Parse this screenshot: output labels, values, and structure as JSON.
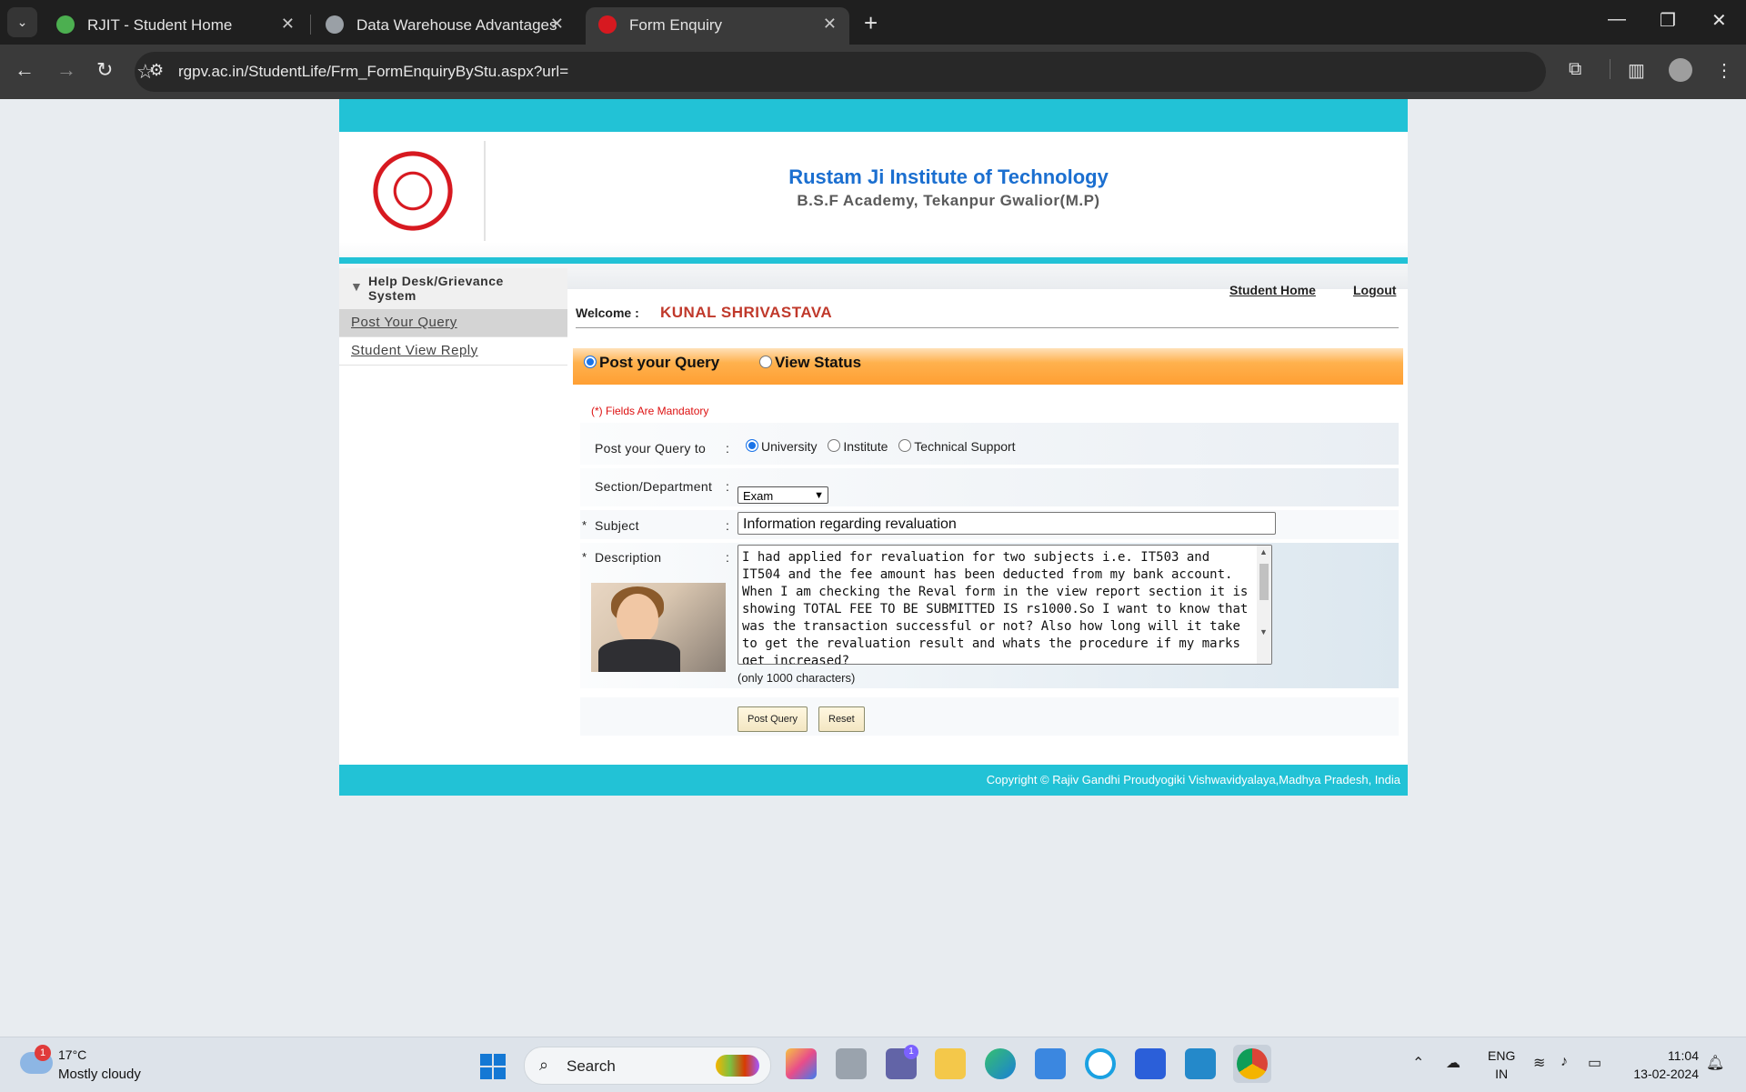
{
  "browser": {
    "tabs": [
      {
        "title": "RJIT - Student Home",
        "active": false
      },
      {
        "title": "Data Warehouse Advantages",
        "active": false
      },
      {
        "title": "Form Enquiry",
        "active": true
      }
    ],
    "url": "rgpv.ac.in/StudentLife/Frm_FormEnquiryByStu.aspx?url="
  },
  "header": {
    "institute_name": "Rustam Ji Institute of Technology",
    "institute_address": "B.S.F Academy, Tekanpur Gwalior(M.P)"
  },
  "sidebar": {
    "heading": "Help Desk/Grievance System",
    "items": [
      {
        "label": "Post Your Query",
        "selected": true
      },
      {
        "label": "Student View Reply",
        "selected": false
      }
    ]
  },
  "top_links": {
    "student_home": "Student Home",
    "logout": "Logout"
  },
  "welcome": {
    "label": "Welcome :",
    "name": "KUNAL SHRIVASTAVA"
  },
  "mode": {
    "post_query": "Post your Query",
    "view_status": "View Status",
    "selected": "post_query"
  },
  "form": {
    "mandatory_note": "(*) Fields Are Mandatory",
    "query_to": {
      "label": "Post your Query  to",
      "options": [
        "University",
        "Institute",
        "Technical Support"
      ],
      "selected": "University"
    },
    "section": {
      "label": "Section/Department",
      "value": "Exam"
    },
    "subject": {
      "label": "Subject",
      "value": "Information regarding revaluation"
    },
    "description": {
      "label": "Description",
      "value": "I had applied for revaluation for two subjects i.e. IT503 and IT504 and the fee amount has been deducted from my bank account. When I am checking the Reval form in the view report section it is showing TOTAL FEE TO BE SUBMITTED IS rs1000.So I want to know that was the transaction successful or not? Also how long will it take to get the revaluation result and whats the procedure if my marks get increased?",
      "hint": "(only 1000 characters)"
    },
    "buttons": {
      "post": "Post Query",
      "reset": "Reset"
    }
  },
  "footer": {
    "copyright": "Copyright © Rajiv Gandhi Proudyogiki Vishwavidyalaya,Madhya Pradesh, India"
  },
  "taskbar": {
    "weather_temp": "17°C",
    "weather_condition": "Mostly cloudy",
    "weather_badge": "1",
    "search_placeholder": "Search",
    "teams_badge": "1",
    "language_line1": "ENG",
    "language_line2": "IN",
    "time": "11:04",
    "date": "13-02-2024"
  },
  "colors": {
    "accent_cyan": "#22c2d6",
    "orange_bar": "#ff9f33",
    "welcome_name": "#c0392b",
    "institute_blue": "#1b6fd0"
  }
}
